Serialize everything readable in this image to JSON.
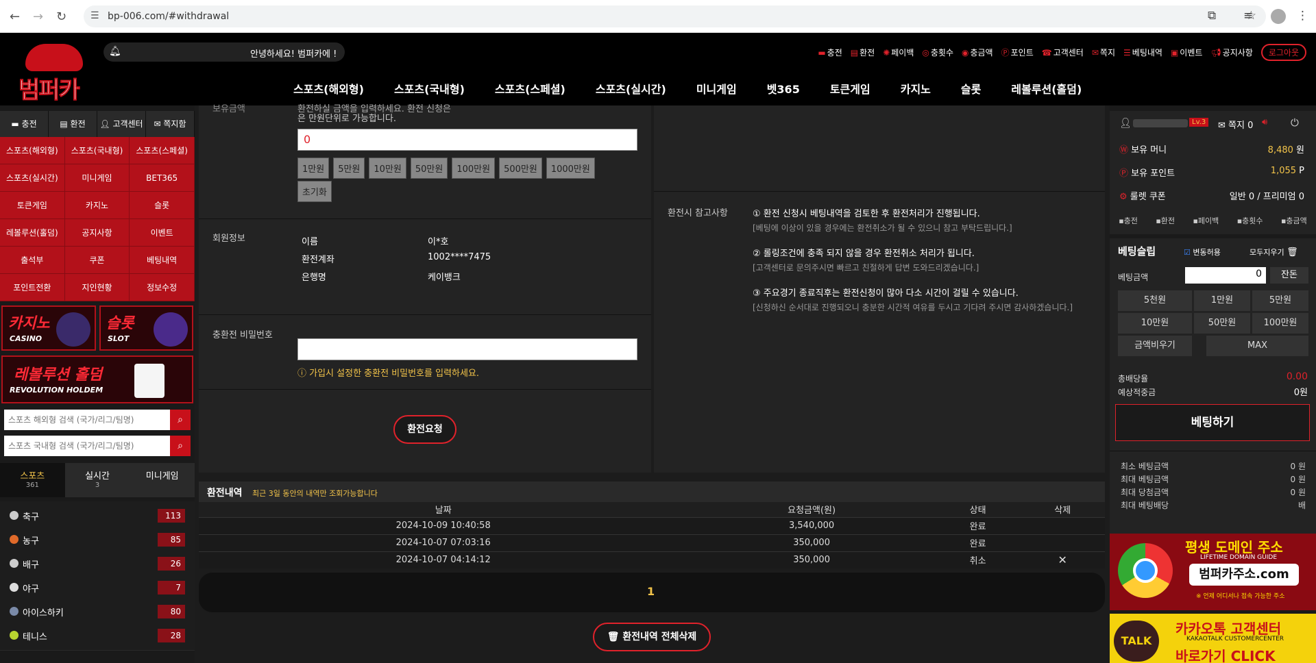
{
  "browser": {
    "url": "bp-006.com/#withdrawal"
  },
  "header": {
    "logo_text": "범퍼카",
    "notice": "안녕하세요! 범퍼카에 !",
    "top_menu": [
      {
        "label": "충전",
        "icon": "card-icon"
      },
      {
        "label": "환전",
        "icon": "money-icon"
      },
      {
        "label": "페이백",
        "icon": "payback-icon"
      },
      {
        "label": "충횟수",
        "icon": "count-icon"
      },
      {
        "label": "충금액",
        "icon": "coin-icon"
      },
      {
        "label": "포인트",
        "icon": "point-icon"
      },
      {
        "label": "고객센터",
        "icon": "support-icon"
      },
      {
        "label": "쪽지",
        "icon": "message-icon"
      },
      {
        "label": "베팅내역",
        "icon": "list-icon"
      },
      {
        "label": "이벤트",
        "icon": "gift-icon"
      },
      {
        "label": "공지사항",
        "icon": "megaphone-icon"
      }
    ],
    "logout": "로그아웃",
    "main_nav": [
      "스포츠(해외형)",
      "스포츠(국내형)",
      "스포츠(스페셜)",
      "스포츠(실시간)",
      "미니게임",
      "벳365",
      "토큰게임",
      "카지노",
      "슬롯",
      "레볼루션(홀덤)"
    ]
  },
  "left": {
    "quick": [
      "충전",
      "환전",
      "고객센터",
      "쪽지함"
    ],
    "grid": [
      "스포츠(해외형)",
      "스포츠(국내형)",
      "스포츠(스페셜)",
      "스포츠(실시간)",
      "미니게임",
      "BET365",
      "토큰게임",
      "카지노",
      "슬롯",
      "레볼루션(홀덤)",
      "공지사항",
      "이벤트",
      "출석부",
      "쿠폰",
      "베팅내역",
      "포인트전환",
      "지인현황",
      "정보수정"
    ],
    "casino_banner": {
      "big": "카지노",
      "small": "CASINO"
    },
    "slot_banner": {
      "big": "슬롯",
      "small": "SLOT"
    },
    "holdem_banner": {
      "big": "레볼루션 홀덤",
      "small": "REVOLUTION HOLDEM"
    },
    "search1_placeholder": "스포츠 해외형 검색 (국가/리그/팀명)",
    "search2_placeholder": "스포츠 국내형 검색 (국가/리그/팀명)",
    "tabs": [
      {
        "label": "스포츠",
        "count": "361"
      },
      {
        "label": "실시간",
        "count": "3"
      },
      {
        "label": "미니게임",
        "count": ""
      }
    ],
    "sports": [
      {
        "name": "축구",
        "count": "113",
        "color": "#cccccc"
      },
      {
        "name": "농구",
        "count": "85",
        "color": "#e06a2a"
      },
      {
        "name": "배구",
        "count": "26",
        "color": "#cccccc"
      },
      {
        "name": "야구",
        "count": "7",
        "color": "#dddddd"
      },
      {
        "name": "아이스하키",
        "count": "80",
        "color": "#7a8aa8"
      },
      {
        "name": "테니스",
        "count": "28",
        "color": "#b8d430"
      }
    ]
  },
  "form": {
    "top_cut": "보유금액",
    "top_desc1": "환전하실 금액을 입력하세요. 환전 신청은",
    "top_desc2": "은 만원단위로 가능합니다.",
    "amount_value": "0",
    "chips": [
      "1만원",
      "5만원",
      "10만원",
      "50만원",
      "100만원",
      "500만원",
      "1000만원"
    ],
    "reset": "초기화",
    "member_label": "회원정보",
    "member": [
      {
        "k": "이름",
        "v": "이*호"
      },
      {
        "k": "환전계좌",
        "v": "1002****7475"
      },
      {
        "k": "은행명",
        "v": "케이뱅크"
      }
    ],
    "pw_label": "충환전 비밀번호",
    "pw_hint": "가입시 설정한 충환전 비밀번호를 입력하세요.",
    "request": "환전요청"
  },
  "notes": {
    "label": "환전시 참고사항",
    "items": [
      {
        "h": "① 환전 신청시 베팅내역을 검토한 후 환전처리가 진행됩니다.",
        "d": "[베팅에 이상이 있을 경우에는 환전취소가 될 수 있으니 참고 부탁드립니다.]"
      },
      {
        "h": "② 롤링조건에 충족 되지 않을 경우 환전취소 처리가 됩니다.",
        "d": "[고객센터로 문의주시면 빠르고 친절하게 답변 도와드리겠습니다.]"
      },
      {
        "h": "③ 주요경기 종료직후는 환전신청이 많아 다소 시간이 걸릴 수 있습니다.",
        "d": "[신청하신 순서대로 진행되오니 충분한 시간적 여유를 두시고 기다려 주시면 감사하겠습니다.]"
      }
    ]
  },
  "history": {
    "title": "환전내역",
    "subtitle": "최근 3일 동안의 내역만 조회가능합니다",
    "columns": [
      "날짜",
      "요청금액(원)",
      "상태",
      "삭제"
    ],
    "rows": [
      {
        "date": "2024-10-09 10:40:58",
        "amount": "3,540,000",
        "status": "완료",
        "del": ""
      },
      {
        "date": "2024-10-07 07:03:16",
        "amount": "350,000",
        "status": "완료",
        "del": ""
      },
      {
        "date": "2024-10-07 04:14:12",
        "amount": "350,000",
        "status": "취소",
        "del": "✕"
      }
    ],
    "page": "1",
    "delete_all": "환전내역 전체삭제"
  },
  "user": {
    "level": "Lv.3",
    "message": "쪽지 0",
    "money_label": "보유 머니",
    "money": "8,480",
    "money_unit": "원",
    "point_label": "보유 포인트",
    "point": "1,055",
    "point_unit": "P",
    "coupon_label": "룰렛 쿠폰",
    "coupon": "일반 0 / 프리미엄 0",
    "quick": [
      "충전",
      "환전",
      "페이백",
      "충횟수",
      "충금액"
    ]
  },
  "slip": {
    "title": "베팅슬립",
    "fix": "변동허용",
    "clear": "모두지우기",
    "amount_label": "베팅금액",
    "amount": "0",
    "balance": "잔돈",
    "buttons": [
      "5천원",
      "1만원",
      "5만원",
      "10만원",
      "50만원",
      "100만원",
      "금액비우기",
      "MAX"
    ],
    "odds_label": "총배당율",
    "odds": "0.00",
    "expected_label": "예상적중금",
    "expected": "0원",
    "bet": "베팅하기",
    "limits": [
      {
        "k": "최소 베팅금액",
        "v": "0 원"
      },
      {
        "k": "최대 베팅금액",
        "v": "0 원"
      },
      {
        "k": "최대 당첨금액",
        "v": "0 원"
      },
      {
        "k": "최대 베팅배당",
        "v": "배"
      }
    ]
  },
  "right_banners": {
    "domain_title": "평생 도메인 주소",
    "domain_sub": "LIFETIME DOMAIN GUIDE",
    "domain_url": "범퍼카주소.com",
    "domain_note": "※ 언제 어디서나 접속 가능한 주소",
    "kakao_title": "카카오톡 고객센터",
    "kakao_sub": "KAKAOTALK CUSTOMERCENTER",
    "kakao_cta": "바로가기 CLICK",
    "kakao_badge": "TALK"
  },
  "colors": {
    "accent": "#e0222b",
    "gold": "#f3c44a",
    "panel": "#232323"
  }
}
